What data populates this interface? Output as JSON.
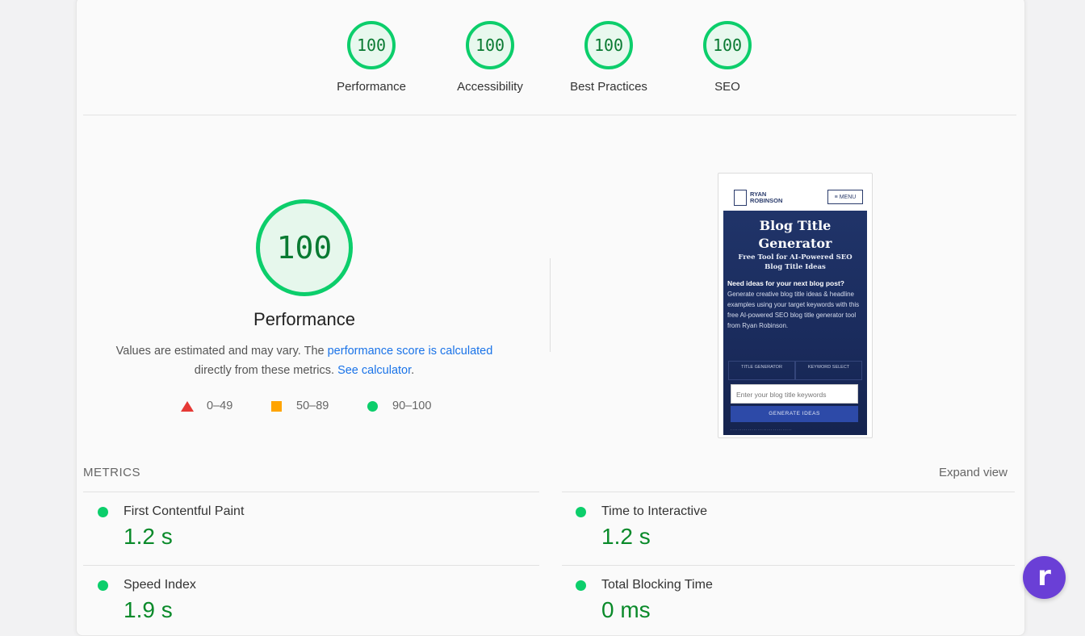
{
  "scores": [
    {
      "value": "100",
      "label": "Performance"
    },
    {
      "value": "100",
      "label": "Accessibility"
    },
    {
      "value": "100",
      "label": "Best Practices"
    },
    {
      "value": "100",
      "label": "SEO"
    }
  ],
  "performance": {
    "score": "100",
    "title": "Performance",
    "desc_1": "Values are estimated and may vary. The ",
    "link_1": "performance score is calculated",
    "desc_2": "directly from these metrics. ",
    "link_2": "See calculator",
    "desc_3": "."
  },
  "legend": [
    {
      "shape": "triangle",
      "range": "0–49",
      "color": "#e53935"
    },
    {
      "shape": "square",
      "range": "50–89",
      "color": "#ffa400"
    },
    {
      "shape": "circle",
      "range": "90–100",
      "color": "#0cce6b"
    }
  ],
  "screenshot": {
    "brand": "RYAN ROBINSON",
    "menu": "≡ MENU",
    "title": "Blog Title Generator",
    "subtitle": "Free Tool for AI-Powered SEO Blog Title Ideas",
    "question": "Need ideas for your next blog post?",
    "body": "Generate creative blog title ideas & headline examples using your target keywords with this free AI-powered SEO blog title generator tool from Ryan Robinson.",
    "tab_1": "TITLE GENERATOR",
    "tab_2": "KEYWORD SELECT",
    "input_placeholder": "Enter your blog title keywords",
    "button": "GENERATE IDEAS",
    "footer": "................................"
  },
  "metrics": {
    "heading": "METRICS",
    "expand": "Expand view",
    "items": [
      {
        "label": "First Contentful Paint",
        "value": "1.2 s"
      },
      {
        "label": "Time to Interactive",
        "value": "1.2 s"
      },
      {
        "label": "Speed Index",
        "value": "1.9 s"
      },
      {
        "label": "Total Blocking Time",
        "value": "0 ms"
      }
    ]
  },
  "colors": {
    "pass": "#0cce6b",
    "pass_text": "#0a8a2a",
    "link": "#1a73e8",
    "fab": "#6a3fd6"
  },
  "fab_icon": "r-logo-icon"
}
